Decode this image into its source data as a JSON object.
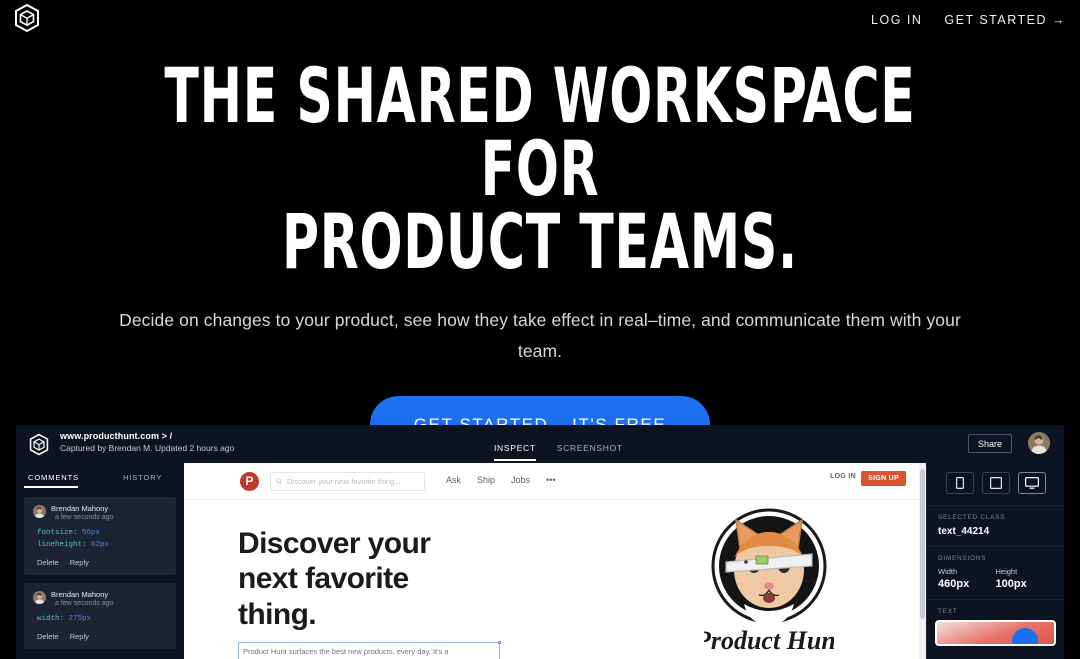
{
  "site": {
    "logo_icon": "hexagon-cube-logo",
    "nav": [
      {
        "label": "LOG IN",
        "name": "log-in"
      },
      {
        "label": "GET STARTED →",
        "name": "get-started"
      }
    ]
  },
  "hero": {
    "title": "THE SHARED WORKSPACE FOR\nPRODUCT TEAMS.",
    "subtitle": "Decide on changes to your product, see how they take effect in real–time, and communicate them with your team.",
    "cta_label": "GET STARTED – IT'S FREE",
    "cta_color": "#1b6ff0",
    "background": "#000000"
  },
  "app": {
    "logo_icon": "hexagon-cube-logo",
    "url": "www.producthunt.com > /",
    "captured": "Captured by Brendan M. Updated 2 hours ago",
    "tabs": [
      {
        "label": "INSPECT",
        "active": true
      },
      {
        "label": "SCREENSHOT",
        "active": false
      }
    ],
    "share_label": "Share",
    "avatar_icon": "user-avatar",
    "comments_panel": {
      "tabs": [
        {
          "label": "COMMENTS",
          "active": true
        },
        {
          "label": "HISTORY",
          "active": false
        }
      ],
      "comments": [
        {
          "author": "Brendan Mahony",
          "time": "a few seconds ago",
          "props": [
            {
              "key": "fontsize:",
              "value": "56px"
            },
            {
              "key": "lineheight:",
              "value": "62px"
            }
          ],
          "actions": [
            "Delete",
            "Reply"
          ]
        },
        {
          "author": "Brendan Mahony",
          "time": "a few seconds ago",
          "props": [
            {
              "key": "width:",
              "value": "275px"
            }
          ],
          "actions": [
            "Delete",
            "Reply"
          ]
        }
      ]
    },
    "preview": {
      "site_logo_letter": "P",
      "search_placeholder": "Discover your next favorite thing...",
      "search_icon": "search-icon",
      "links": [
        "Ask",
        "Ship",
        "Jobs",
        "•••"
      ],
      "login_label": "LOG IN",
      "signup_label": "SIGN UP",
      "signup_color": "#da552f",
      "headline": "Discover your next favorite thing.",
      "paragraph": "Product Hunt surfaces the best new products, every day. It's a",
      "mascot_icon": "producthunt-cat-logo"
    },
    "inspector": {
      "devices": [
        {
          "name": "mobile",
          "icon": "mobile-icon",
          "active": false
        },
        {
          "name": "tablet",
          "icon": "tablet-icon",
          "active": false
        },
        {
          "name": "desktop",
          "icon": "desktop-icon",
          "active": true
        }
      ],
      "selected_class_label": "SELECTED CLASS",
      "selected_class_value": "text_44214",
      "dimensions_label": "DIMENSIONS",
      "width_label": "Width",
      "width_value": "460px",
      "height_label": "Height",
      "height_value": "100px",
      "text_label": "TEXT"
    }
  }
}
